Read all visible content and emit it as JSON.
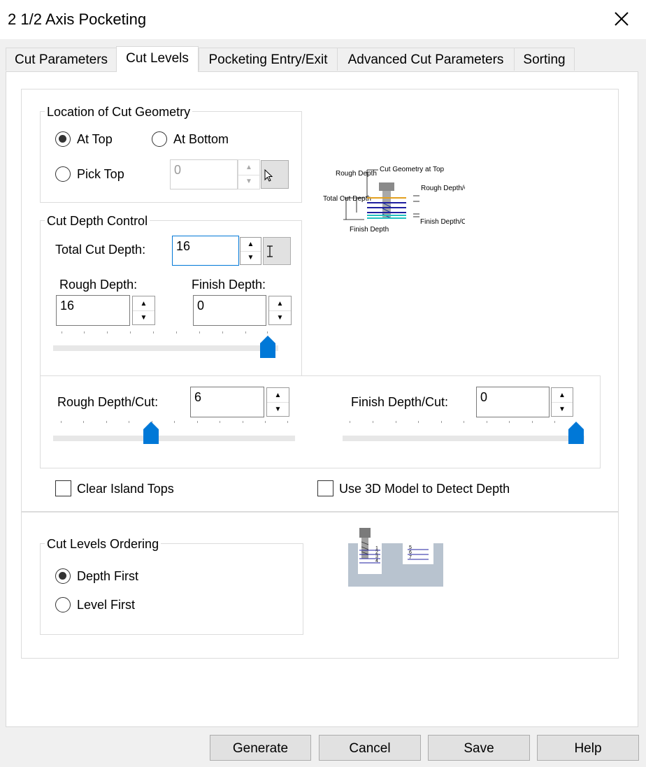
{
  "window": {
    "title": "2 1/2 Axis Pocketing"
  },
  "tabs": [
    {
      "label": "Cut Parameters"
    },
    {
      "label": "Cut Levels"
    },
    {
      "label": "Pocketing Entry/Exit"
    },
    {
      "label": "Advanced Cut Parameters"
    },
    {
      "label": "Sorting"
    }
  ],
  "location": {
    "title": "Location of Cut Geometry",
    "at_top": "At Top",
    "at_bottom": "At Bottom",
    "pick_top": "Pick Top",
    "pick_top_value": "0",
    "selected": "at_top"
  },
  "depth_control": {
    "title": "Cut Depth Control",
    "total_label": "Total Cut Depth:",
    "total_value": "16",
    "rough_label": "Rough Depth:",
    "rough_value": "16",
    "finish_label": "Finish Depth:",
    "finish_value": "0",
    "split_slider_fraction": 1.0
  },
  "diagram": {
    "rough_depth": "Rough Depth",
    "cut_geometry_at_top": "Cut Geometry at Top",
    "rough_depth_per_cut": "Rough Depth/Cut",
    "total_cut_depth": "Total Cut Depth",
    "finish_depth": "Finish Depth",
    "finish_depth_per_cut": "Finish Depth/Cut"
  },
  "per_cut": {
    "rough_label": "Rough Depth/Cut:",
    "rough_value": "6",
    "rough_slider_fraction": 0.4,
    "finish_label": "Finish Depth/Cut:",
    "finish_value": "0",
    "finish_slider_fraction": 1.0
  },
  "options": {
    "clear_island_tops": "Clear Island Tops",
    "use_3d_model": "Use 3D Model to Detect Depth"
  },
  "ordering": {
    "title": "Cut Levels Ordering",
    "depth_first": "Depth First",
    "level_first": "Level First",
    "selected": "depth_first",
    "levels_left": [
      "1",
      "2",
      "3",
      "4"
    ],
    "levels_right": [
      "5",
      "6",
      "7"
    ]
  },
  "buttons": {
    "generate": "Generate",
    "cancel": "Cancel",
    "save": "Save",
    "help": "Help"
  },
  "colors": {
    "accent": "#0078d7",
    "slider_thumb": "#0078d7"
  }
}
